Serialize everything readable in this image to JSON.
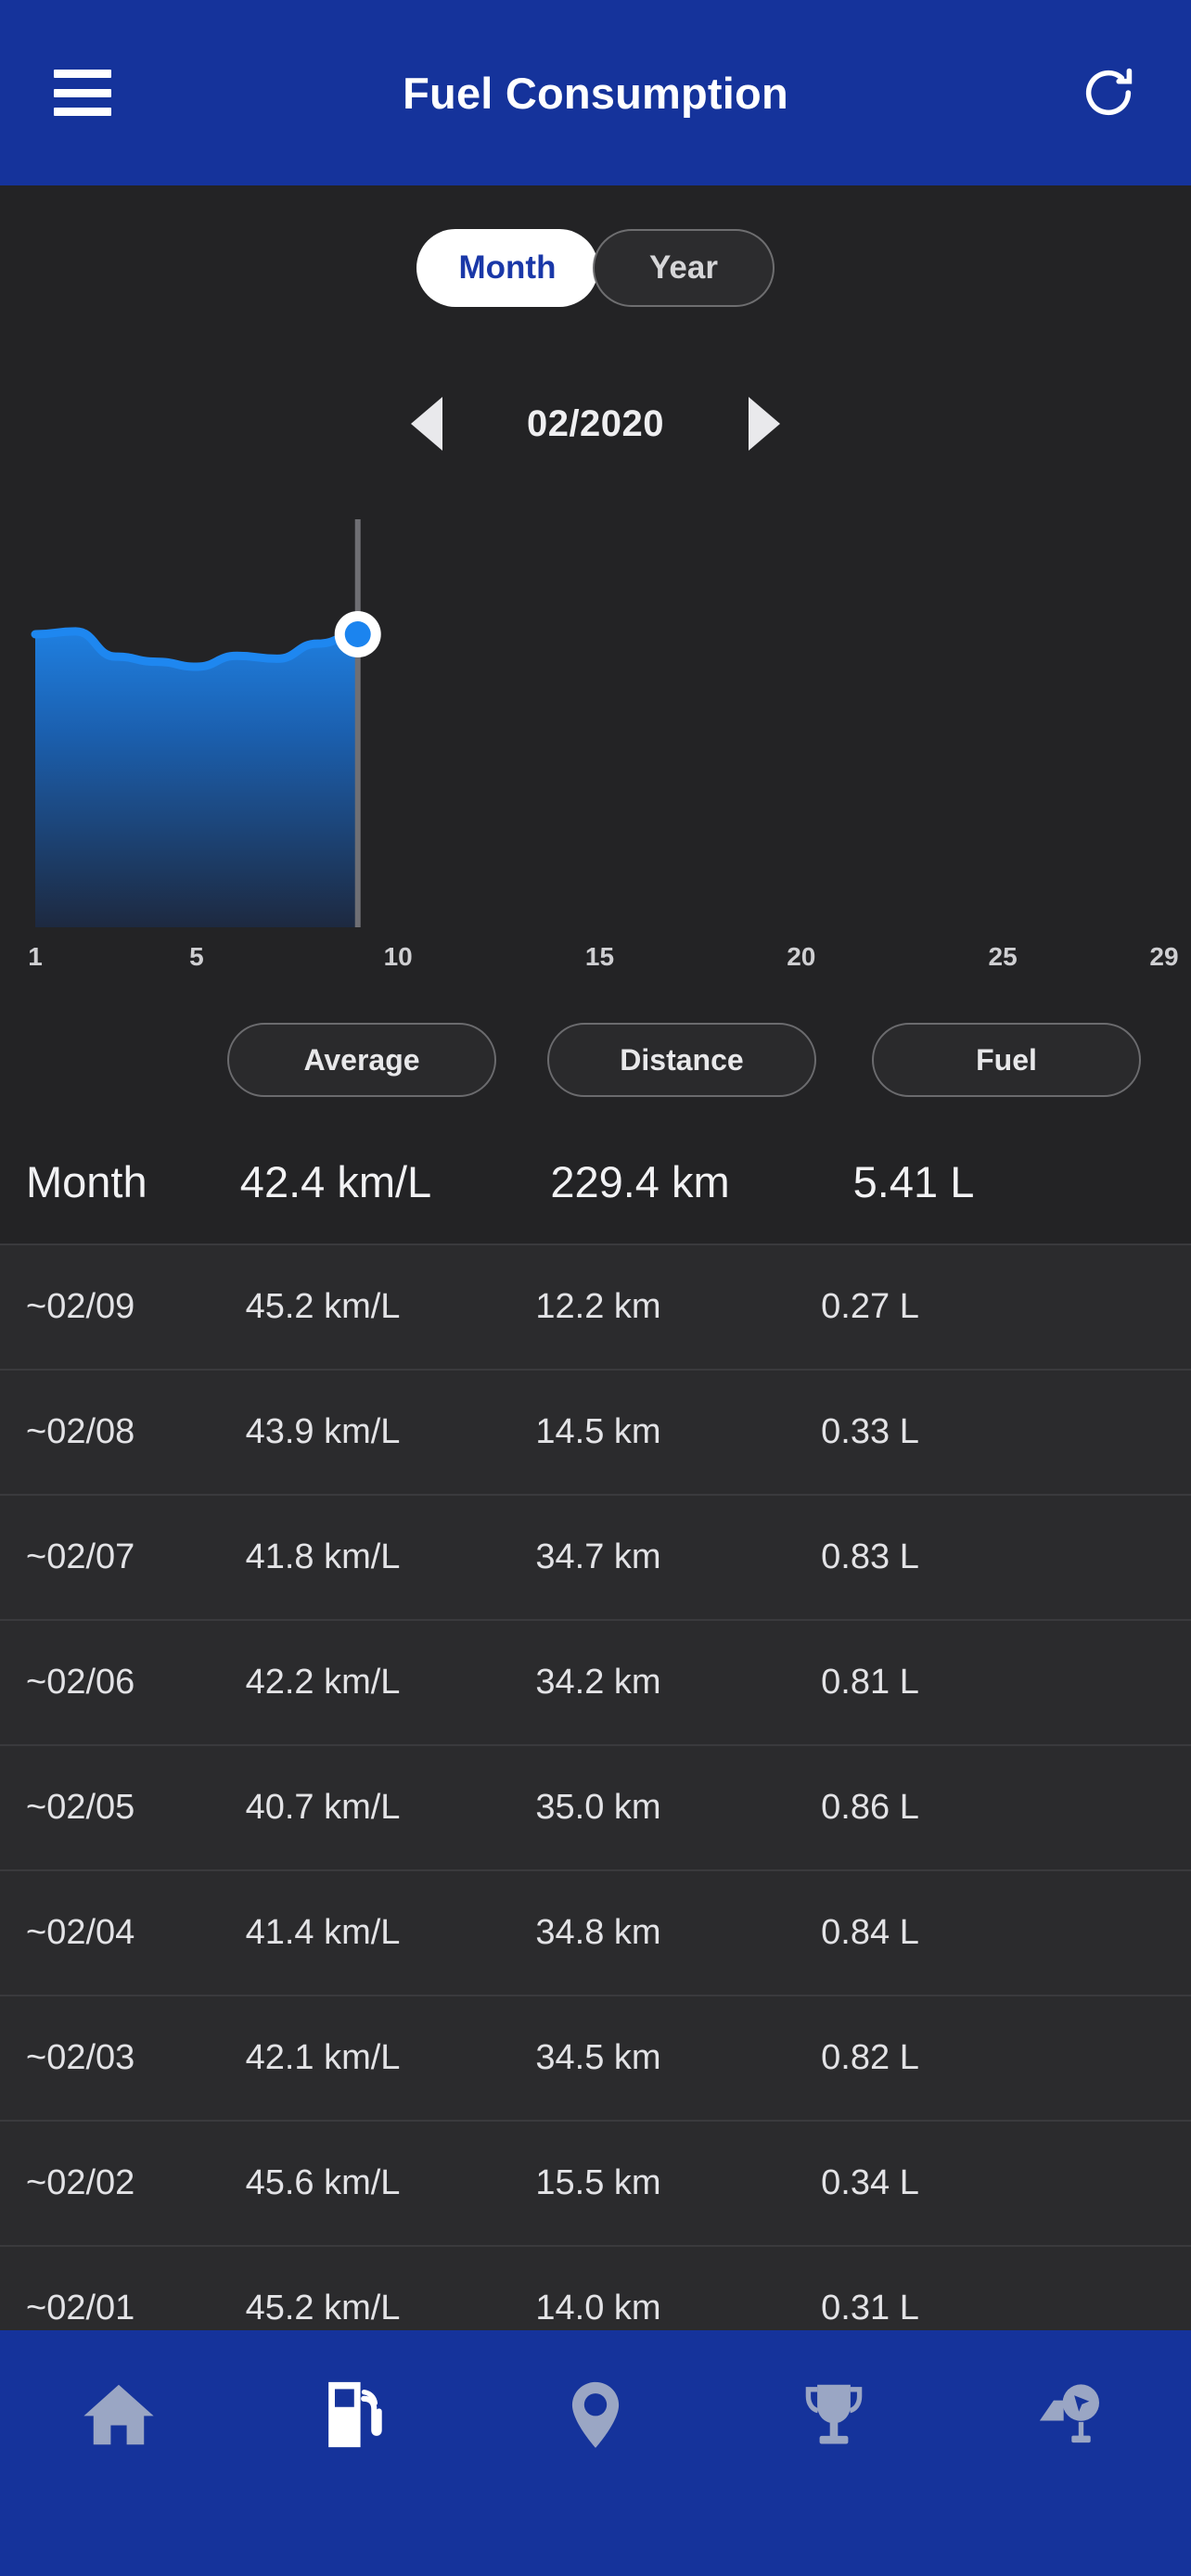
{
  "header": {
    "title": "Fuel Consumption",
    "menu_icon": "hamburger-menu-icon",
    "refresh_icon": "refresh-icon",
    "bg_color": "#15339B"
  },
  "period_toggle": {
    "options": [
      {
        "label": "Month",
        "selected": true
      },
      {
        "label": "Year",
        "selected": false
      }
    ],
    "active_text_color": "#1a38a8",
    "active_bg_color": "#ffffff"
  },
  "date_stepper": {
    "prev_icon": "triangle-left-icon",
    "next_icon": "triangle-right-icon",
    "value": "02/2020"
  },
  "chart_data": {
    "type": "area",
    "title": "",
    "xlabel": "",
    "ylabel": "",
    "x": [
      1,
      2,
      3,
      4,
      5,
      6,
      7,
      8,
      9
    ],
    "values": [
      45.2,
      45.6,
      42.1,
      41.4,
      40.7,
      42.2,
      41.8,
      43.9,
      45.2
    ],
    "tick_labels": [
      "1",
      "5",
      "10",
      "15",
      "20",
      "25",
      "29"
    ],
    "tick_positions": [
      1,
      5,
      10,
      15,
      20,
      25,
      29
    ],
    "xlim": [
      1,
      29
    ],
    "ylim": [
      0,
      50
    ],
    "grid": false,
    "legend": "none",
    "line_color": "#1e87f0",
    "fill_top_color": "#1565c8",
    "fill_bottom_color": "#1d2a40",
    "marker": {
      "x": 9,
      "value": 45.2,
      "dot_color": "#1b84ef",
      "ring_color": "#ffffff"
    },
    "indicator_line_color": "#6f6f74"
  },
  "column_buttons": [
    {
      "label": "Average"
    },
    {
      "label": "Distance"
    },
    {
      "label": "Fuel"
    }
  ],
  "table": {
    "summary": {
      "label": "Month",
      "average": "42.4 km/L",
      "distance": "229.4 km",
      "fuel": "5.41 L"
    },
    "rows": [
      {
        "label": "~02/09",
        "average": "45.2 km/L",
        "distance": "12.2 km",
        "fuel": "0.27 L"
      },
      {
        "label": "~02/08",
        "average": "43.9 km/L",
        "distance": "14.5 km",
        "fuel": "0.33 L"
      },
      {
        "label": "~02/07",
        "average": "41.8 km/L",
        "distance": "34.7 km",
        "fuel": "0.83 L"
      },
      {
        "label": "~02/06",
        "average": "42.2 km/L",
        "distance": "34.2 km",
        "fuel": "0.81 L"
      },
      {
        "label": "~02/05",
        "average": "40.7 km/L",
        "distance": "35.0 km",
        "fuel": "0.86 L"
      },
      {
        "label": "~02/04",
        "average": "41.4 km/L",
        "distance": "34.8 km",
        "fuel": "0.84 L"
      },
      {
        "label": "~02/03",
        "average": "42.1 km/L",
        "distance": "34.5 km",
        "fuel": "0.82 L"
      },
      {
        "label": "~02/02",
        "average": "45.6 km/L",
        "distance": "15.5 km",
        "fuel": "0.34 L"
      },
      {
        "label": "~02/01",
        "average": "45.2 km/L",
        "distance": "14.0 km",
        "fuel": "0.31 L"
      }
    ]
  },
  "bottom_nav": {
    "bg_color": "#15339B",
    "items": [
      {
        "icon": "home-icon",
        "active": false
      },
      {
        "icon": "fuel-pump-icon",
        "active": true
      },
      {
        "icon": "map-pin-icon",
        "active": false
      },
      {
        "icon": "trophy-icon",
        "active": false
      },
      {
        "icon": "road-sign-icon",
        "active": false
      }
    ],
    "inactive_color": "#9aa6c4",
    "active_color": "#ffffff"
  }
}
